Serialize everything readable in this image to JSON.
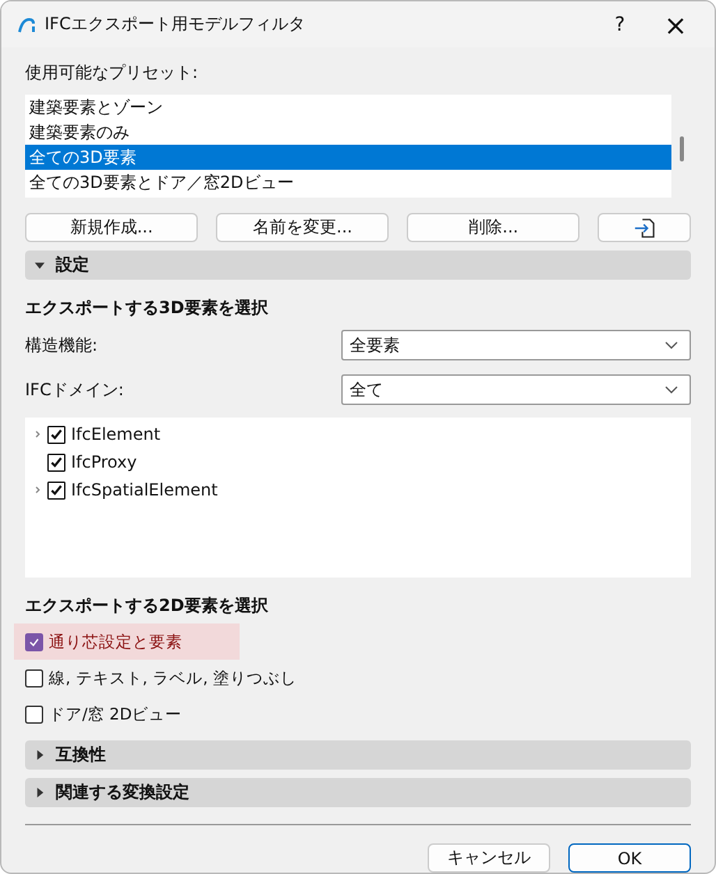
{
  "window": {
    "title": "IFCエクスポート用モデルフィルタ",
    "help": "?",
    "close": "×"
  },
  "presets": {
    "label": "使用可能なプリセット:",
    "items": [
      {
        "label": "建築要素とゾーン",
        "selected": false
      },
      {
        "label": "建築要素のみ",
        "selected": false
      },
      {
        "label": "全ての3D要素",
        "selected": true
      },
      {
        "label": "全ての3D要素とドア／窓2Dビュー",
        "selected": false
      }
    ]
  },
  "preset_buttons": [
    "新規作成...",
    "名前を変更...",
    "削除..."
  ],
  "sections": [
    {
      "title": "設定",
      "expanded": true
    },
    {
      "title": "互換性",
      "expanded": false
    },
    {
      "title": "関連する変換設定",
      "expanded": false
    }
  ],
  "select_3d": {
    "heading": "エクスポートする3D要素を選択",
    "fields": [
      {
        "label": "構造機能:",
        "value": "全要素"
      },
      {
        "label": "IFCドメイン:",
        "value": "全て"
      }
    ],
    "tree": [
      {
        "label": "IfcElement",
        "checked": true,
        "has_children": true
      },
      {
        "label": "IfcProxy",
        "checked": true,
        "has_children": false
      },
      {
        "label": "IfcSpatialElement",
        "checked": true,
        "has_children": true
      }
    ]
  },
  "select_2d": {
    "heading": "エクスポートする2D要素を選択",
    "options": [
      {
        "label": "通り芯設定と要素",
        "checked": true,
        "highlighted": true
      },
      {
        "label": "線, テキスト, ラベル, 塗りつぶし",
        "checked": false,
        "highlighted": false
      },
      {
        "label": "ドア/窓 2Dビュー",
        "checked": false,
        "highlighted": false
      }
    ]
  },
  "footer_buttons": [
    {
      "label": "キャンセル",
      "default": false
    },
    {
      "label": "OK",
      "default": true
    }
  ]
}
